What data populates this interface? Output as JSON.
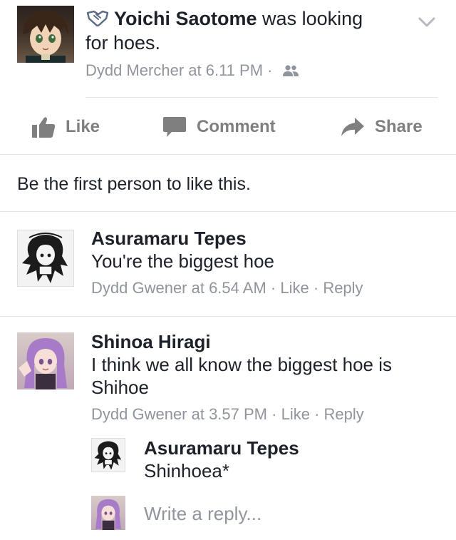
{
  "post": {
    "author": "Yoichi Saotome",
    "status_line1": " was looking",
    "status_line2": "for hoes.",
    "meta_place": "Dydd Mercher at 6.11 PM",
    "meta_sep": " ·",
    "feeling_icon": "handshake-icon",
    "audience_icon": "friends-icon",
    "menu_icon": "chevron-down-icon"
  },
  "actions": {
    "like": "Like",
    "comment": "Comment",
    "share": "Share"
  },
  "likes_summary": "Be the first person to like this.",
  "comments": [
    {
      "name": "Asuramaru Tepes",
      "text": "You're the biggest hoe",
      "time": "Dydd Gwener at 6.54 AM",
      "like": "Like",
      "reply": "Reply"
    },
    {
      "name": "Shinoa Hiragi",
      "text_line1": "I think we all know the biggest hoe is",
      "text_line2": "Shihoe",
      "time": "Dydd Gwener at 3.57 PM",
      "like": "Like",
      "reply": "Reply"
    }
  ],
  "reply": {
    "name": "Asuramaru Tepes",
    "text": "Shinhoea*"
  },
  "reply_box": {
    "placeholder": "Write a reply..."
  },
  "colors": {
    "text": "#1d2129",
    "meta": "#90949c",
    "action": "#7f7f7f",
    "divider": "#e5e6e9"
  }
}
